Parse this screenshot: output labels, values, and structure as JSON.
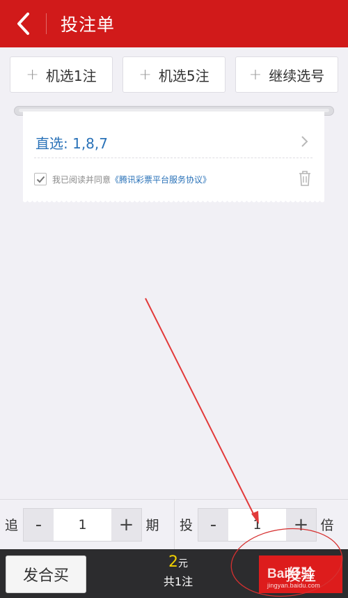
{
  "header": {
    "title": "投注单",
    "back_icon": "chevron-left-icon",
    "background": "#d11a1a"
  },
  "quick_buttons": [
    {
      "label": "机选1注",
      "icon": "plus-icon"
    },
    {
      "label": "机选5注",
      "icon": "plus-icon"
    },
    {
      "label": "继续选号",
      "icon": "plus-icon"
    }
  ],
  "ticket": {
    "selection": "直选: 1,8,7",
    "agreement_text": "我已阅读并同意",
    "agreement_link": "《腾讯彩票平台服务协议》",
    "agreement_checked": true
  },
  "controls": {
    "chase": {
      "label": "追",
      "value": "1",
      "unit": "期",
      "minus": "-",
      "plus": "+"
    },
    "multiple": {
      "label": "投",
      "value": "1",
      "unit": "倍",
      "minus": "-",
      "plus": "+"
    }
  },
  "footer": {
    "hemai_label": "发合买",
    "amount": "2",
    "currency": "元",
    "count_text": "共1注",
    "bet_label": "投注",
    "accent": "#dd1c1c",
    "amount_color": "#f0d000"
  },
  "watermark": {
    "brand": "Bai经验",
    "url": "jingyan.baidu.com"
  }
}
